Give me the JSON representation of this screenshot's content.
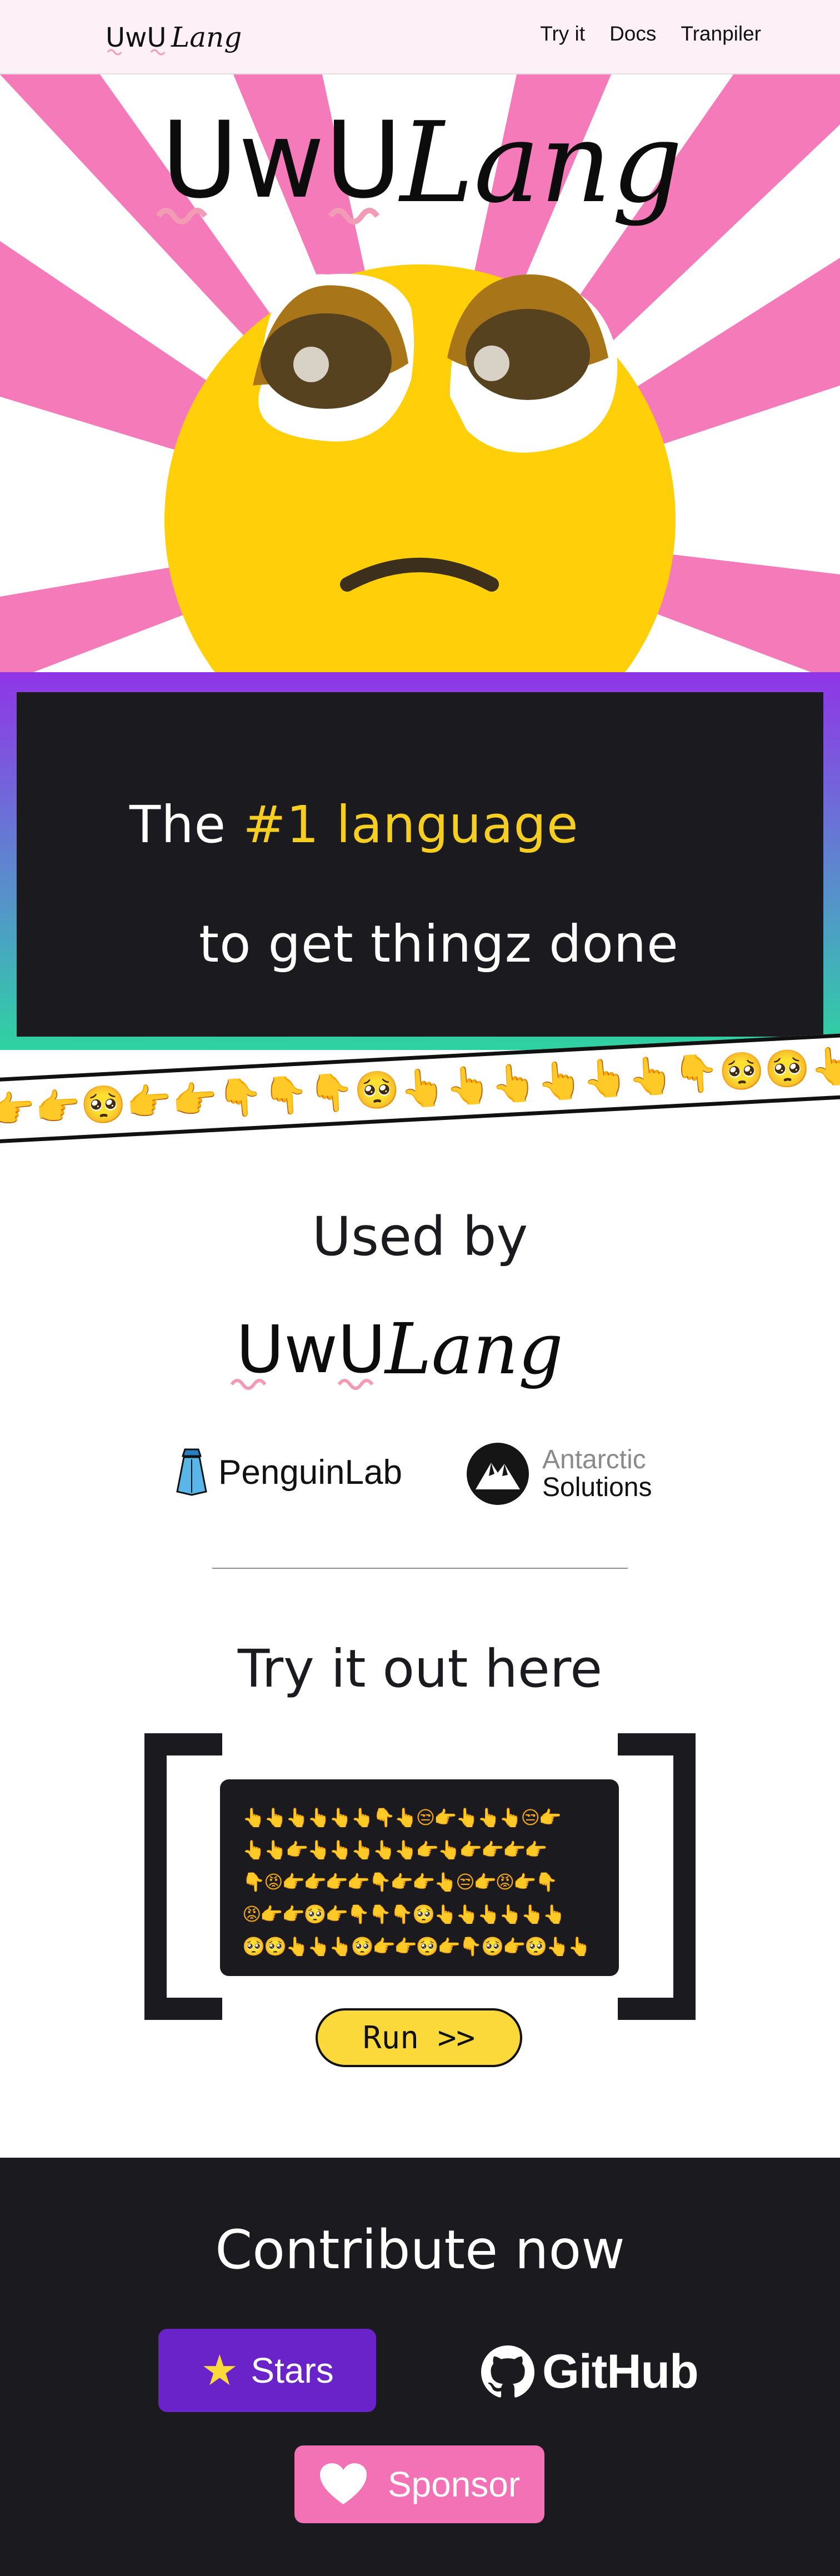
{
  "brand": {
    "logo_text_main": "UwU",
    "logo_text_lang": "Lang"
  },
  "nav": {
    "links": [
      {
        "label": "Try it"
      },
      {
        "label": "Docs"
      },
      {
        "label": "Tranpiler"
      }
    ]
  },
  "banner": {
    "line1_prefix": "The ",
    "line1_highlight": "#1 language",
    "line2": "to get thingz done",
    "highlight_color": "#f6cd21",
    "strip_emojis": "👉👉🥺👉👉👇👇👇🥺👆👆👆👆👆👆👇🥺🥺👆👆👇👇👉👉🥺👉👉👇👇"
  },
  "used_by": {
    "title": "Used by",
    "partners": [
      {
        "name": "PenguinLab"
      },
      {
        "name_line1": "Antarctic",
        "name_line2": "Solutions"
      }
    ]
  },
  "try_it": {
    "title": "Try it out here",
    "code": "👆👆👆👆👆👆👇👆😒👉👆👆👆😒👉\n👆👆👉👆👆👆👆👆👉👆👉👉👉👉\n👇😡👉👉👉👉👇👉👉👆😒👉😡👉👇\n😡👉👉🥺👉👇👇👇🥺👆👆👆👆👆👆\n🥺🥺👆👆👆🥺👉👉🥺👉👇🥺👉🥺👆👆",
    "run_label": "Run  >>"
  },
  "contribute": {
    "title": "Contribute now",
    "stars_label": "Stars",
    "github_label": "GitHub",
    "sponsor_label": "Sponsor"
  },
  "colors": {
    "dark": "#1b1a1e",
    "accent_yellow": "#fbd93b",
    "pink": "#f372b5",
    "purple": "#6a22c9",
    "hero_ray_pink": "#f57aba",
    "emoji_face": "#ffcf0a"
  },
  "icons": [
    "logo-face",
    "tie-icon",
    "mountain-icon",
    "star-icon",
    "github-icon",
    "heart-icon"
  ]
}
